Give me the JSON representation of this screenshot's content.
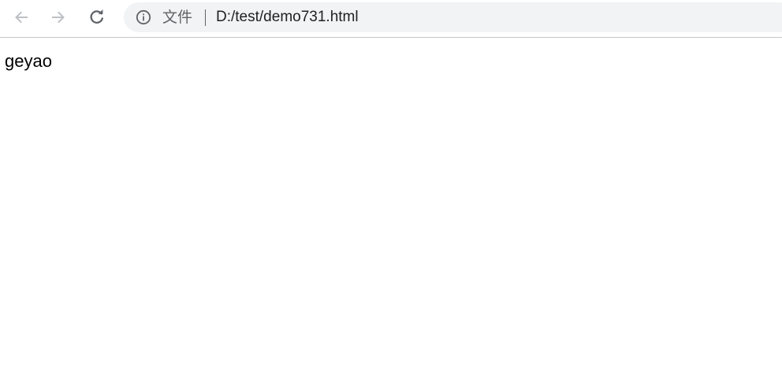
{
  "browser": {
    "toolbar": {
      "back_icon": "arrow-left-icon",
      "forward_icon": "arrow-right-icon",
      "reload_icon": "reload-icon"
    },
    "address_bar": {
      "security_icon": "info-icon",
      "scheme_label": "文件",
      "url": "D:/test/demo731.html"
    }
  },
  "page": {
    "body_text": "geyao"
  },
  "colors": {
    "toolbar_bg": "#ffffff",
    "omnibox_bg": "#f1f3f4",
    "icon_disabled": "#bdc1c6",
    "icon_active": "#5f6368",
    "text": "#202124"
  }
}
